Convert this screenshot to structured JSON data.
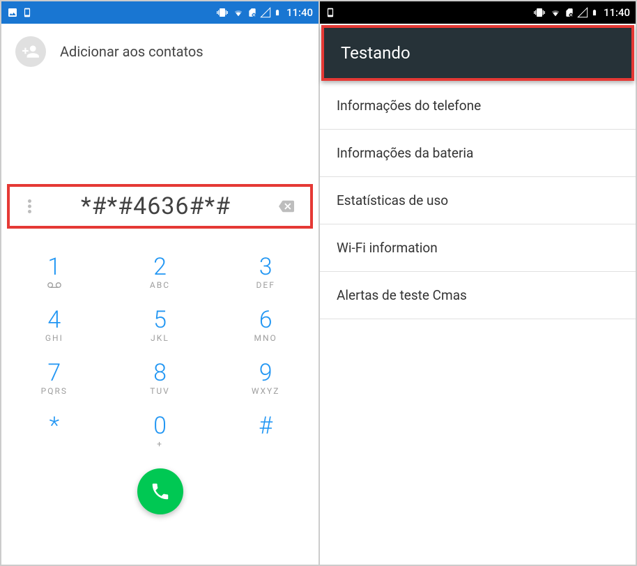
{
  "status": {
    "time": "11:40"
  },
  "dialer": {
    "add_contact_label": "Adicionar aos contatos",
    "dialed_number": "*#*#4636#*#",
    "keys": [
      {
        "digit": "1",
        "letters": ""
      },
      {
        "digit": "2",
        "letters": "ABC"
      },
      {
        "digit": "3",
        "letters": "DEF"
      },
      {
        "digit": "4",
        "letters": "GHI"
      },
      {
        "digit": "5",
        "letters": "JKL"
      },
      {
        "digit": "6",
        "letters": "MNO"
      },
      {
        "digit": "7",
        "letters": "PQRS"
      },
      {
        "digit": "8",
        "letters": "TUV"
      },
      {
        "digit": "9",
        "letters": "WXYZ"
      },
      {
        "digit": "*",
        "letters": ""
      },
      {
        "digit": "0",
        "letters": "+"
      },
      {
        "digit": "#",
        "letters": ""
      }
    ]
  },
  "testing": {
    "title": "Testando",
    "items": [
      "Informações do telefone",
      "Informações da bateria",
      "Estatísticas de uso",
      "Wi-Fi information",
      "Alertas de teste Cmas"
    ]
  }
}
